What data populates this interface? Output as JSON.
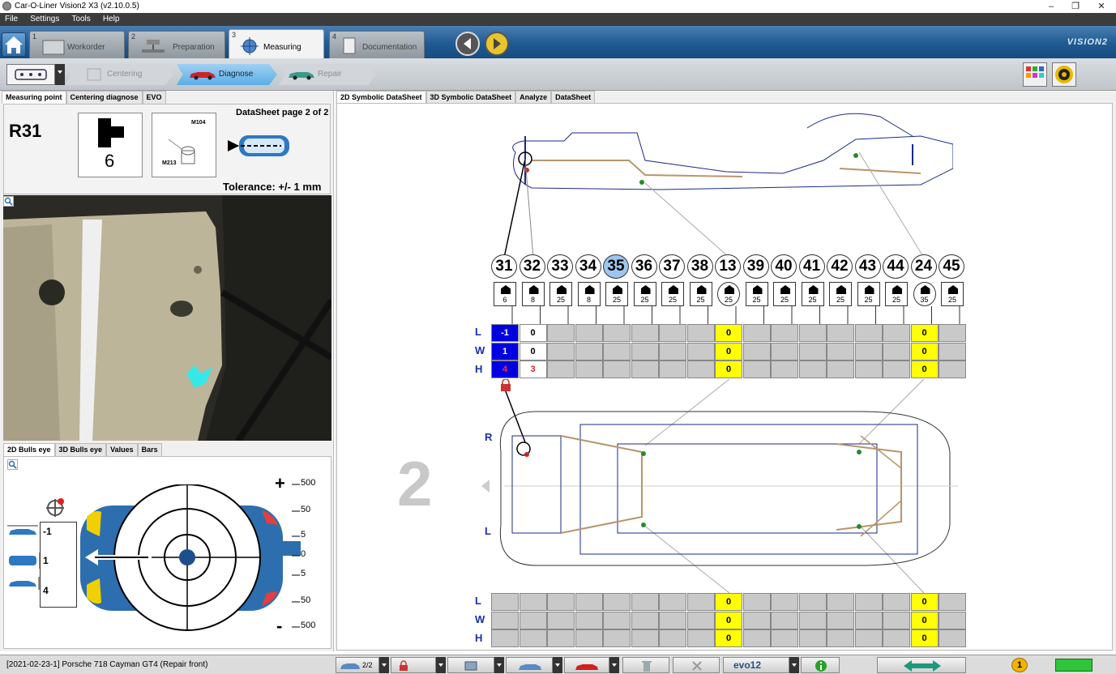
{
  "window": {
    "title": "Car-O-Liner Vision2 X3 (v2.10.0.5)",
    "min": "–",
    "restore": "❐",
    "close": "✕"
  },
  "menu": [
    "File",
    "Settings",
    "Tools",
    "Help"
  ],
  "workflow": {
    "tabs": [
      {
        "num": "1",
        "label": "Workorder"
      },
      {
        "num": "2",
        "label": "Preparation"
      },
      {
        "num": "3",
        "label": "Measuring"
      },
      {
        "num": "4",
        "label": "Documentation"
      }
    ],
    "brand": "VISION2"
  },
  "steps": [
    "Centering",
    "Diagnose",
    "Repair"
  ],
  "left_tabs": [
    "Measuring point",
    "Centering diagnose",
    "EVO"
  ],
  "point": {
    "id": "R31",
    "icon_number": "6",
    "ref_a": "M104",
    "ref_b": "M213",
    "datasheet_page": "DataSheet page 2 of 2",
    "tolerance": "Tolerance: +/- 1 mm"
  },
  "bull_tabs": [
    "2D Bulls eye",
    "3D Bulls eye",
    "Values",
    "Bars"
  ],
  "bull": {
    "values": [
      "-1",
      "1",
      "4"
    ],
    "scale": [
      "500",
      "50",
      "5",
      "0",
      "5",
      "50",
      "500"
    ],
    "plus": "+",
    "minus": "-"
  },
  "right_tabs": [
    "2D Symbolic DataSheet",
    "3D Symbolic DataSheet",
    "Analyze",
    "DataSheet"
  ],
  "points": [
    "31",
    "32",
    "33",
    "34",
    "35",
    "36",
    "37",
    "38",
    "13",
    "39",
    "40",
    "41",
    "42",
    "43",
    "44",
    "24",
    "45"
  ],
  "point_sizes": [
    "6",
    "8",
    "25",
    "8",
    "25",
    "25",
    "25",
    "25",
    "25",
    "25",
    "25",
    "25",
    "25",
    "25",
    "25",
    "35",
    "25"
  ],
  "upper_table": {
    "labels": [
      "L",
      "W",
      "H"
    ],
    "rows": [
      [
        "-1",
        "0",
        "",
        "",
        "",
        "",
        "",
        "",
        "0",
        "",
        "",
        "",
        "",
        "",
        "",
        "0",
        ""
      ],
      [
        "1",
        "0",
        "",
        "",
        "",
        "",
        "",
        "",
        "0",
        "",
        "",
        "",
        "",
        "",
        "",
        "0",
        ""
      ],
      [
        "4",
        "3",
        "",
        "",
        "",
        "",
        "",
        "",
        "0",
        "",
        "",
        "",
        "",
        "",
        "",
        "0",
        ""
      ]
    ]
  },
  "lower_table": {
    "labels": [
      "L",
      "W",
      "H"
    ],
    "rows": [
      [
        "",
        "",
        "",
        "",
        "",
        "",
        "",
        "",
        "0",
        "",
        "",
        "",
        "",
        "",
        "",
        "0",
        ""
      ],
      [
        "",
        "",
        "",
        "",
        "",
        "",
        "",
        "",
        "0",
        "",
        "",
        "",
        "",
        "",
        "",
        "0",
        ""
      ],
      [
        "",
        "",
        "",
        "",
        "",
        "",
        "",
        "",
        "0",
        "",
        "",
        "",
        "",
        "",
        "",
        "0",
        ""
      ]
    ]
  },
  "side_labels": {
    "right": "R",
    "left": "L"
  },
  "page_number": "2",
  "status": {
    "info": "[2021-02-23-1]  Porsche 718 Cayman GT4 (Repair front)",
    "car_page": "2/2",
    "evo": "evo12",
    "badge": "1"
  },
  "colors": {
    "accent_blue": "#1f5a92",
    "highlight": "#ffff00",
    "selected": "#9cc6ee",
    "measure_blue": "#0000e0"
  }
}
